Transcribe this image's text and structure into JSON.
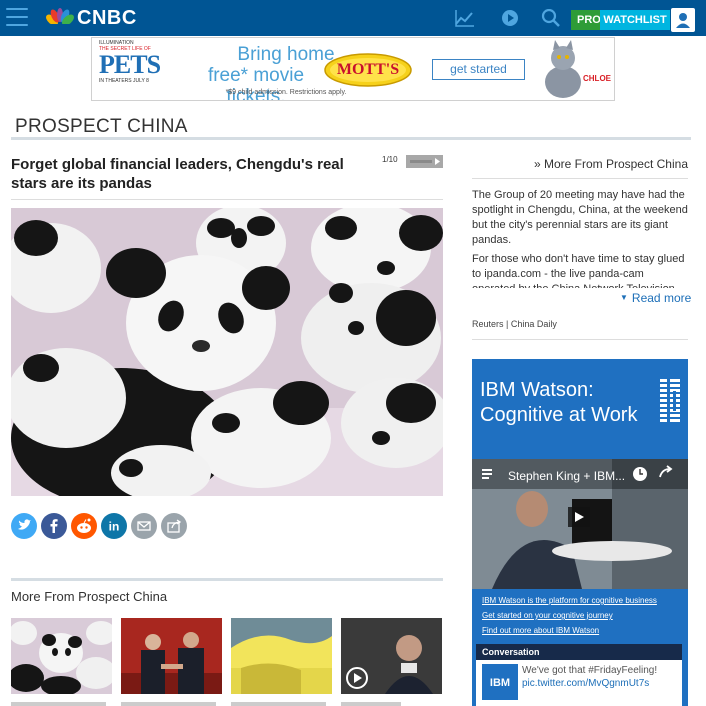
{
  "header": {
    "logo_text": "CNBC",
    "pro_label": "PRO",
    "watchlist_label": "WATCHLIST",
    "bg_color": "#005594"
  },
  "ad_banner": {
    "poster_studio": "ILLUMINATION",
    "poster_subtitle": "THE SECRET LIFE OF",
    "poster_title": "PETS",
    "poster_date": "IN THEATERS JULY 8",
    "headline_line1": "Bring home",
    "headline_line2": "free* movie tickets.",
    "fine_print": "*$9 child admission. Restrictions apply.",
    "brand": "MOTT'S",
    "cta": "get started",
    "character_name": "CHLOE"
  },
  "section": {
    "title": "PROSPECT CHINA"
  },
  "article": {
    "title": "Forget global financial leaders, Chengdu's real stars are its pandas",
    "counter": "1/10",
    "photo_icon": "pandas-photo"
  },
  "share_buttons": [
    {
      "name": "twitter-icon",
      "color": "#3fa9f5"
    },
    {
      "name": "facebook-icon",
      "color": "#3b5998"
    },
    {
      "name": "reddit-icon",
      "color": "#ff5700"
    },
    {
      "name": "linkedin-icon",
      "color": "#0e76a8"
    },
    {
      "name": "email-icon",
      "color": "#9aa4ab"
    },
    {
      "name": "share-icon",
      "color": "#9aa4ab"
    }
  ],
  "more_section": {
    "title": "More From Prospect China"
  },
  "sidebar": {
    "more_link": "» More From Prospect China",
    "paragraph1": "The Group of 20 meeting may have had the spotlight in Chengdu, China, at the weekend but the city's perennial stars are its giant pandas.",
    "paragraph2": "For those who don't have time to stay glued to ipanda.com - the live panda-cam operated by the China Network Television with",
    "read_more": "Read more",
    "credits": "Reuters | China Daily"
  },
  "ibm_ad": {
    "title": "IBM Watson: Cognitive at Work",
    "video_title": "Stephen King + IBM...",
    "link1": "IBM Watson is the platform for cognitive business",
    "link2": "Get started on your cognitive journey",
    "link3": "Find out more about IBM Watson",
    "conversation_label": "Conversation",
    "tweet_text": "We've got that #FridayFeeling!",
    "tweet_link": "pic.twitter.com/MvQgnmUt7s"
  }
}
